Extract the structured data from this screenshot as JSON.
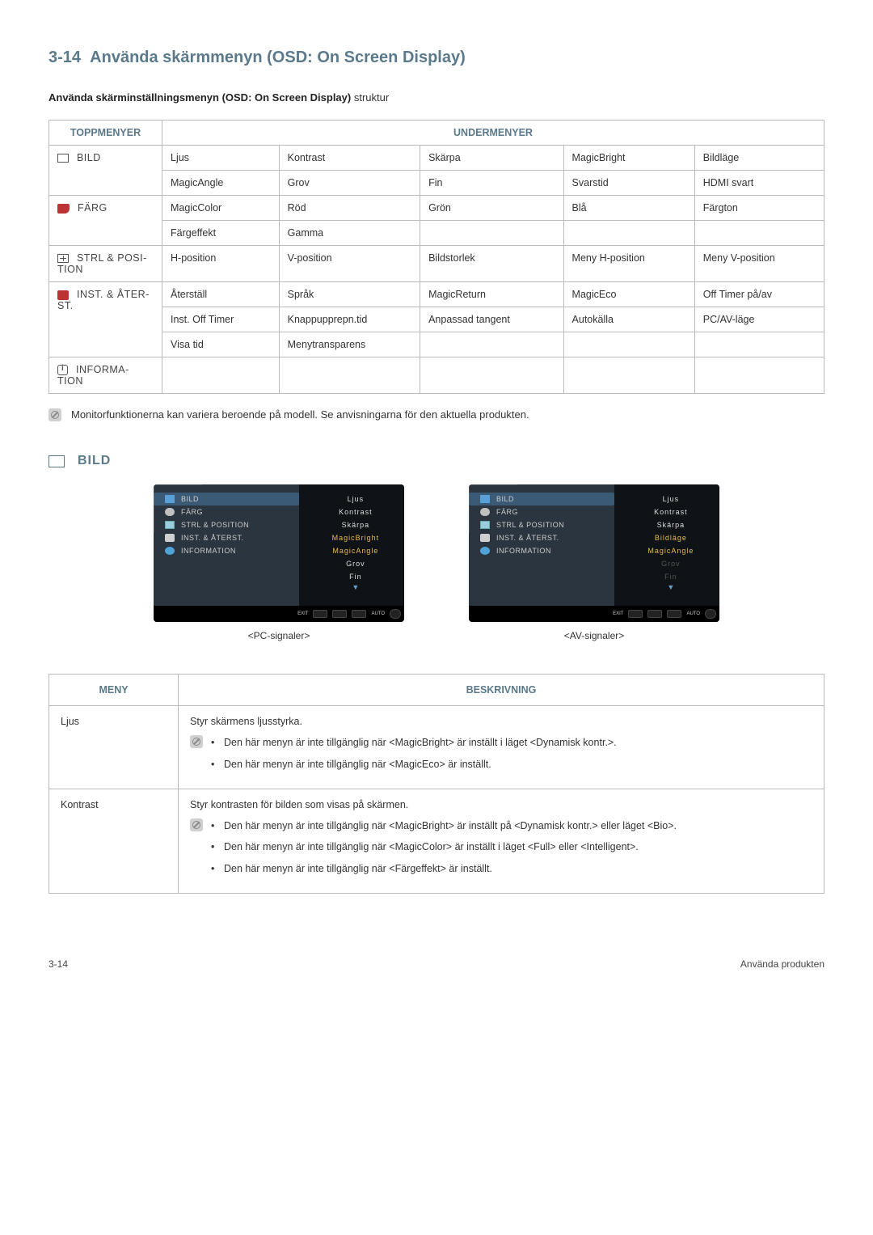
{
  "heading_number": "3-14",
  "heading_text": "Använda skärmmenyn (OSD: On Screen Display)",
  "subheading_bold": "Använda skärminställningsmenyn (OSD: On Screen Display)",
  "subheading_rest": " struktur",
  "table_headers": {
    "top": "TOPPMENYER",
    "sub": "UNDERMENYER"
  },
  "menu_rows": [
    {
      "top": "BILD",
      "icon": "box",
      "sub_rows": [
        [
          "Ljus",
          "Kontrast",
          "Skärpa",
          "MagicBright",
          "Bildläge"
        ],
        [
          "MagicAngle",
          "Grov",
          "Fin",
          "Svarstid",
          "HDMI svart"
        ]
      ]
    },
    {
      "top": "FÄRG",
      "icon": "palette",
      "sub_rows": [
        [
          "MagicColor",
          "Röd",
          "Grön",
          "Blå",
          "Färgton"
        ],
        [
          "Färgeffekt",
          "Gamma",
          "",
          "",
          ""
        ]
      ]
    },
    {
      "top": "STRL & POSI-TION",
      "icon": "cross",
      "sub_rows": [
        [
          "H-position",
          "V-position",
          "Bildstorlek",
          "Meny H-position",
          "Meny V-position"
        ]
      ]
    },
    {
      "top": "INST. & ÅTER-ST.",
      "icon": "gear",
      "sub_rows": [
        [
          "Återställ",
          "Språk",
          "MagicReturn",
          "MagicEco",
          "Off Timer på/av"
        ],
        [
          "Inst. Off Timer",
          "Knappupprepn.tid",
          "Anpassad tangent",
          "Autokälla",
          "PC/AV-läge"
        ],
        [
          "Visa tid",
          "Menytransparens",
          "",
          "",
          ""
        ]
      ]
    },
    {
      "top": "INFORMA-TION",
      "icon": "info",
      "sub_rows": [
        [
          "",
          "",
          "",
          "",
          ""
        ]
      ]
    }
  ],
  "note_text": "Monitorfunktionerna kan variera beroende på modell. Se anvisningarna för den aktuella produkten.",
  "section_bild": "BILD",
  "osd": {
    "left_menu": [
      "BILD",
      "FÄRG",
      "STRL & POSITION",
      "INST. & ÅTERST.",
      "INFORMATION"
    ],
    "pc": {
      "caption": "<PC-signaler>",
      "sub": [
        {
          "label": "Ljus",
          "dim": false,
          "hi": false
        },
        {
          "label": "Kontrast",
          "dim": false,
          "hi": false
        },
        {
          "label": "Skärpa",
          "dim": false,
          "hi": false
        },
        {
          "label": "MagicBright",
          "dim": false,
          "hi": true
        },
        {
          "label": "MagicAngle",
          "dim": false,
          "hi": true
        },
        {
          "label": "Grov",
          "dim": false,
          "hi": false
        },
        {
          "label": "Fin",
          "dim": false,
          "hi": false
        }
      ]
    },
    "av": {
      "caption": "<AV-signaler>",
      "sub": [
        {
          "label": "Ljus",
          "dim": false,
          "hi": false
        },
        {
          "label": "Kontrast",
          "dim": false,
          "hi": false
        },
        {
          "label": "Skärpa",
          "dim": false,
          "hi": false
        },
        {
          "label": "Bildläge",
          "dim": false,
          "hi": true
        },
        {
          "label": "MagicAngle",
          "dim": false,
          "hi": true
        },
        {
          "label": "Grov",
          "dim": true,
          "hi": false
        },
        {
          "label": "Fin",
          "dim": true,
          "hi": false
        }
      ]
    },
    "bottom_labels": {
      "exit": "EXIT",
      "auto": "AUTO"
    }
  },
  "desc_table": {
    "headers": {
      "menu": "MENY",
      "desc": "BESKRIVNING"
    },
    "rows": [
      {
        "menu": "Ljus",
        "intro": "Styr skärmens ljusstyrka.",
        "notes": [
          "Den här menyn är inte tillgänglig när <MagicBright> är inställt i läget <Dynamisk kontr.>.",
          "Den här menyn är inte tillgänglig när <MagicEco> är inställt."
        ]
      },
      {
        "menu": "Kontrast",
        "intro": "Styr kontrasten för bilden som visas på skärmen.",
        "notes": [
          "Den här menyn är inte tillgänglig när <MagicBright> är inställt på <Dynamisk kontr.> eller läget <Bio>.",
          "Den här menyn är inte tillgänglig när <MagicColor> är inställt i läget <Full> eller <Intelligent>.",
          "Den här menyn är inte tillgänglig när <Färgeffekt> är inställt."
        ]
      }
    ]
  },
  "footer": {
    "left": "3-14",
    "right": "Använda produkten"
  }
}
